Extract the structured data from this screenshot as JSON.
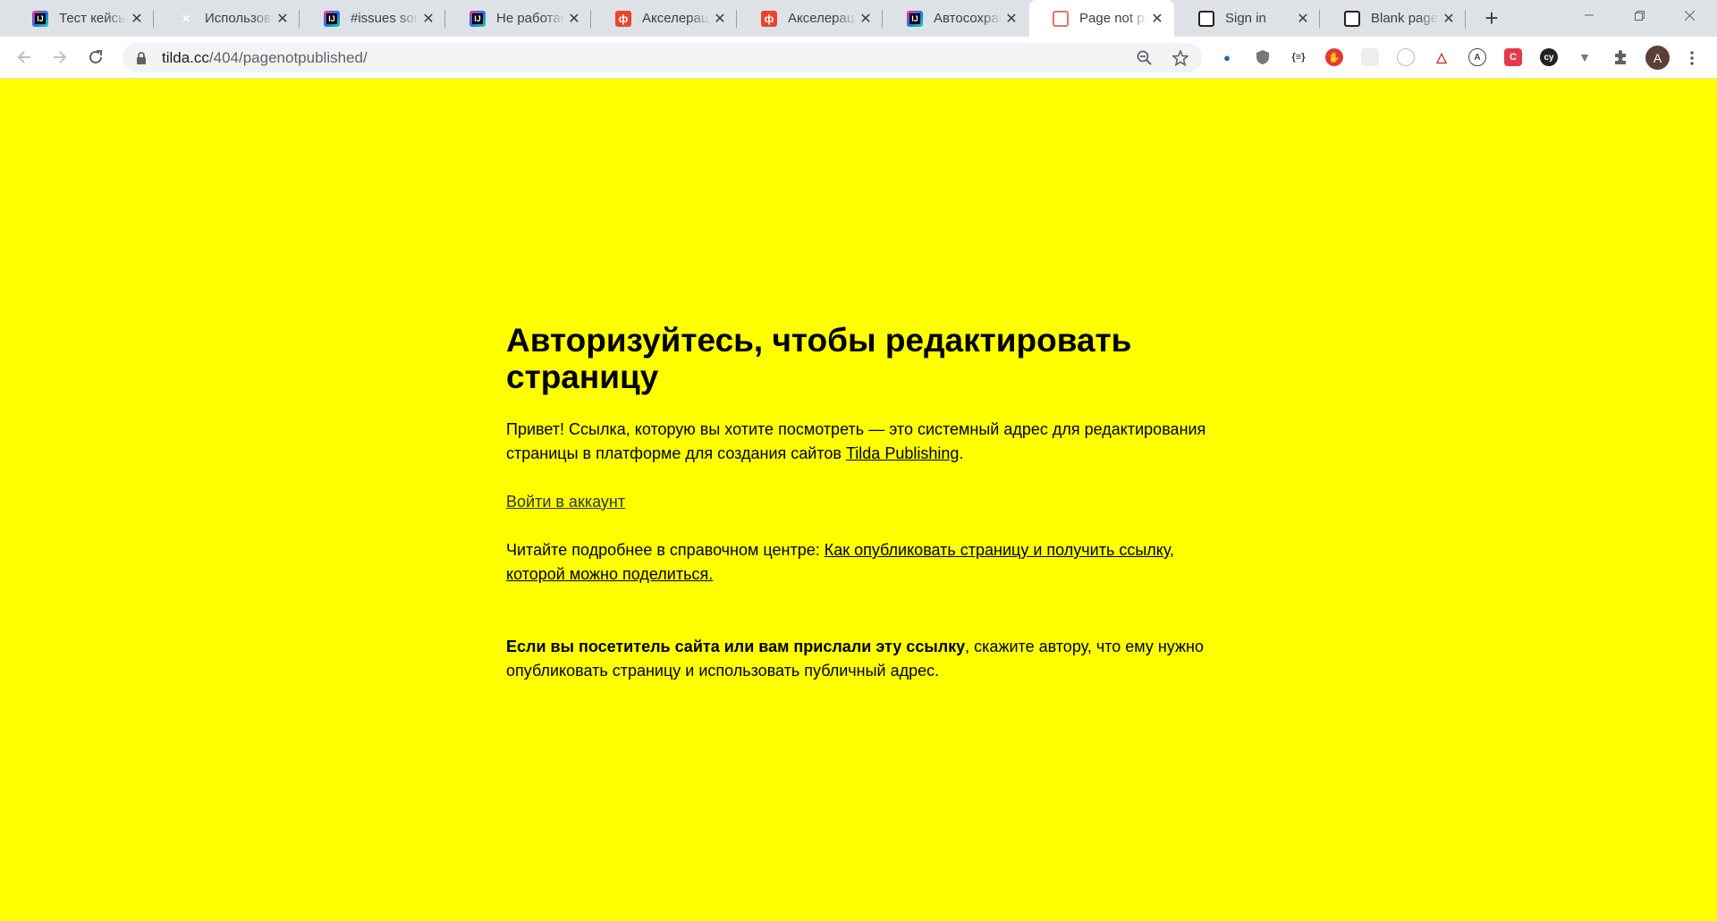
{
  "browser": {
    "tabs": [
      {
        "title": "Тест кейсы / ",
        "favicon": "intellij-icon"
      },
      {
        "title": "Использова",
        "favicon": "x-logo-icon"
      },
      {
        "title": "#issues sort",
        "favicon": "intellij-icon"
      },
      {
        "title": "Не работает",
        "favicon": "intellij-icon"
      },
      {
        "title": "Акселераци",
        "favicon": "phi-icon"
      },
      {
        "title": "Акселераци",
        "favicon": "phi-icon"
      },
      {
        "title": "Автосохран",
        "favicon": "intellij-icon"
      },
      {
        "title": "Page not pu",
        "favicon": "page-icon",
        "active": true
      },
      {
        "title": "Sign in",
        "favicon": "tilda-icon"
      },
      {
        "title": "Blank page",
        "favicon": "tilda-icon"
      }
    ],
    "new_tab_glyph": "+",
    "url_host": "tilda.cc",
    "url_path": "/404/pagenotpublished/",
    "avatar_letter": "A",
    "extensions": [
      "ext-1-icon",
      "ext-2-icon",
      "ext-3-icon",
      "ext-4-icon",
      "ext-5-icon",
      "ext-6-icon",
      "ext-7-icon",
      "ext-8-icon",
      "ext-9-icon",
      "ext-10-icon",
      "ext-11-icon",
      "puzzle-icon"
    ]
  },
  "page": {
    "background": "#ffff00",
    "title": "Авторизуйтесь, чтобы редактировать страницу",
    "intro_text": "Привет! Ссылка, которую вы хотите посмотреть — это системный адрес для редактирования страницы в платформе для создания сайтов ",
    "intro_link": "Tilda Publishing",
    "intro_end": ".",
    "login_link": "Войти в аккаунт",
    "help_text": "Читайте подробнее в справочном центре: ",
    "help_link": "Как опубликовать страницу и получить ссылку, которой можно поделиться.",
    "visitor_bold": "Если вы посетитель сайта или вам прислали эту ссылку",
    "visitor_text": ", скажите автору, что ему нужно опубликовать страницу и использовать публичный адрес."
  }
}
